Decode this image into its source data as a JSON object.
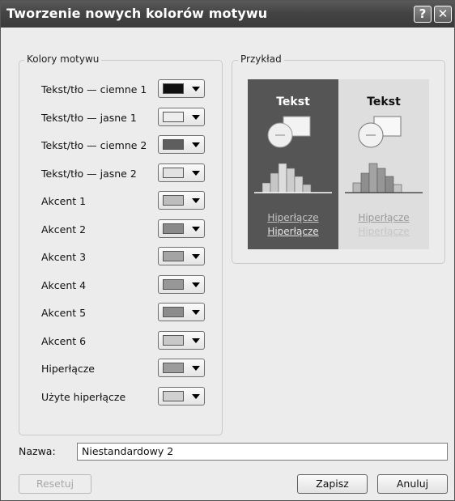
{
  "dialog": {
    "title": "Tworzenie nowych kolorów motywu",
    "help_glyph": "?",
    "close_glyph": "✕"
  },
  "theme_colors": {
    "group_label": "Kolory motywu",
    "rows": [
      {
        "label": "Tekst/tło — ciemne 1",
        "swatch": "#101010"
      },
      {
        "label": "Tekst/tło — jasne 1",
        "swatch": "#eeeeee"
      },
      {
        "label": "Tekst/tło — ciemne 2",
        "swatch": "#5e5e5e"
      },
      {
        "label": "Tekst/tło — jasne 2",
        "swatch": "#e2e2e2"
      },
      {
        "label": "Akcent 1",
        "swatch": "#bdbdbd"
      },
      {
        "label": "Akcent 2",
        "swatch": "#8a8a8a"
      },
      {
        "label": "Akcent 3",
        "swatch": "#a4a4a4"
      },
      {
        "label": "Akcent 4",
        "swatch": "#979797"
      },
      {
        "label": "Akcent 5",
        "swatch": "#8c8c8c"
      },
      {
        "label": "Akcent 6",
        "swatch": "#c8c8c8"
      },
      {
        "label": "Hiperłącze",
        "swatch": "#9c9c9c"
      },
      {
        "label": "Użyte hiperłącze",
        "swatch": "#d0d0d0"
      }
    ]
  },
  "preview": {
    "group_label": "Przykład",
    "dark_text": "Tekst",
    "light_text": "Tekst",
    "dark_link1": "Hiperłącze",
    "dark_link2": "Hiperłącze",
    "light_link1": "Hiperłącze",
    "light_link2": "Hiperłącze"
  },
  "name_field": {
    "label": "Nazwa:",
    "value": "Niestandardowy 2"
  },
  "buttons": {
    "reset": "Resetuj",
    "save": "Zapisz",
    "cancel": "Anuluj"
  }
}
